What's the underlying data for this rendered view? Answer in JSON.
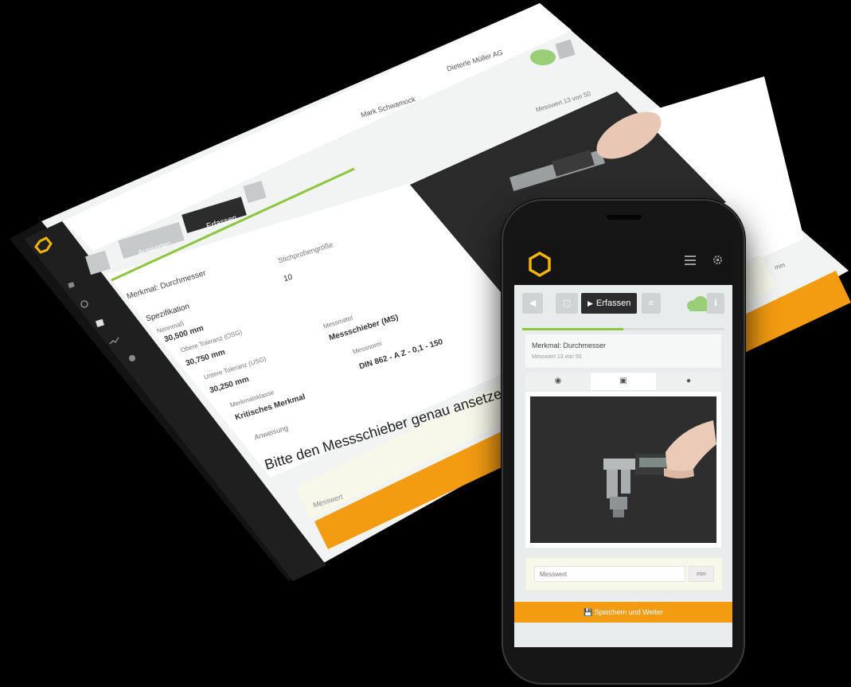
{
  "tablet": {
    "user_menu": "Mark Schwamock",
    "company_menu": "Dieterle Müller AG",
    "measurement_counter": "Messwert 13 von 50",
    "btn_erfassen": "Erfassen",
    "btn_auswerten": "Auswerten",
    "feature_title": "Merkmal: Durchmesser",
    "sample_size_label": "Stichprobengröße",
    "sample_size_value": "10",
    "spec_label": "Spezifikation",
    "nominal_label": "Nennmaß",
    "nominal_value": "30,500 mm",
    "upper_label": "Obere Toleranz (OSG)",
    "upper_value": "30,750 mm",
    "lower_label": "Untere Toleranz (USG)",
    "lower_value": "30,250 mm",
    "class_label": "Merkmalsklasse",
    "class_value": "Kritisches Merkmal",
    "tool_label": "Messmittel",
    "tool_value": "Messschieber (MS)",
    "norm_label": "Messnorm",
    "norm_value": "DIN 862 - A Z - 0,1 - 150",
    "instruction_label": "Anweisung",
    "instruction_text": "Bitte den Messschieber genau ansetzen wie",
    "input_placeholder": "Messwert",
    "unit_button": "mm"
  },
  "phone": {
    "btn_erfassen": "Erfassen",
    "feature_title": "Merkmal: Durchmesser",
    "measurement_counter": "Messwert 13 von 50",
    "input_placeholder": "Messwert",
    "unit_button": "mm",
    "save_button": "Speichern und Weiter",
    "progress": 0.5
  },
  "colors": {
    "accent_orange": "#f39c12",
    "progress_green": "#8cc63f",
    "logo_yellow": "#f5b400",
    "dark_header": "#141414",
    "cloud_green": "#9bcf77"
  }
}
